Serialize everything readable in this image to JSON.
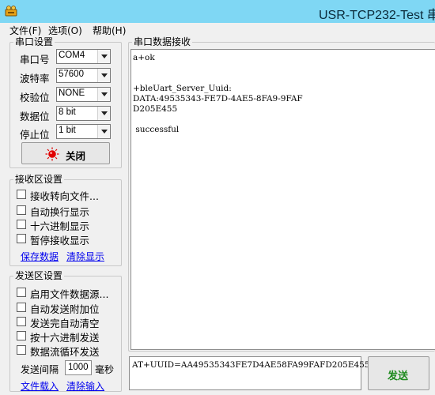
{
  "window": {
    "title": "USR-TCP232-Test 串"
  },
  "menu": [
    "文件(F)",
    "选项(O)",
    "帮助(H)"
  ],
  "serial_settings": {
    "title": "串口设置",
    "rows": [
      {
        "label": "串口号",
        "value": "COM4"
      },
      {
        "label": "波特率",
        "value": "57600"
      },
      {
        "label": "校验位",
        "value": "NONE"
      },
      {
        "label": "数据位",
        "value": "8 bit"
      },
      {
        "label": "停止位",
        "value": "1 bit"
      }
    ],
    "close_button_label": "关闭",
    "status_color": "#e00000"
  },
  "receive_settings": {
    "title": "接收区设置",
    "options": [
      "接收转向文件...",
      "自动换行显示",
      "十六进制显示",
      "暂停接收显示"
    ],
    "save_link": "保存数据",
    "clear_link": "清除显示"
  },
  "send_settings": {
    "title": "发送区设置",
    "options": [
      "启用文件数据源...",
      "自动发送附加位",
      "发送完自动清空",
      "按十六进制发送",
      "数据流循环发送"
    ],
    "interval_label": "发送间隔",
    "interval_value": "1000",
    "interval_unit": "毫秒",
    "load_link": "文件载入",
    "clear_link": "清除输入"
  },
  "receive_area": {
    "title": "串口数据接收",
    "lines": [
      "a+ok",
      "",
      "",
      "+bleUart_Server_Uuid:",
      "DATA:49535343-FE7D-4AE5-8FA9-9FAF",
      "D205E455",
      "",
      " successful"
    ]
  },
  "send_area": {
    "input_value": "AT+UUID=AA49535343FE7D4AE58FA99FAFD205E455",
    "send_button_label": "发送"
  },
  "colors": {
    "titlebar": "#7fd7f4",
    "link": "#0000ee",
    "send_button_text": "#1d8a1d"
  }
}
